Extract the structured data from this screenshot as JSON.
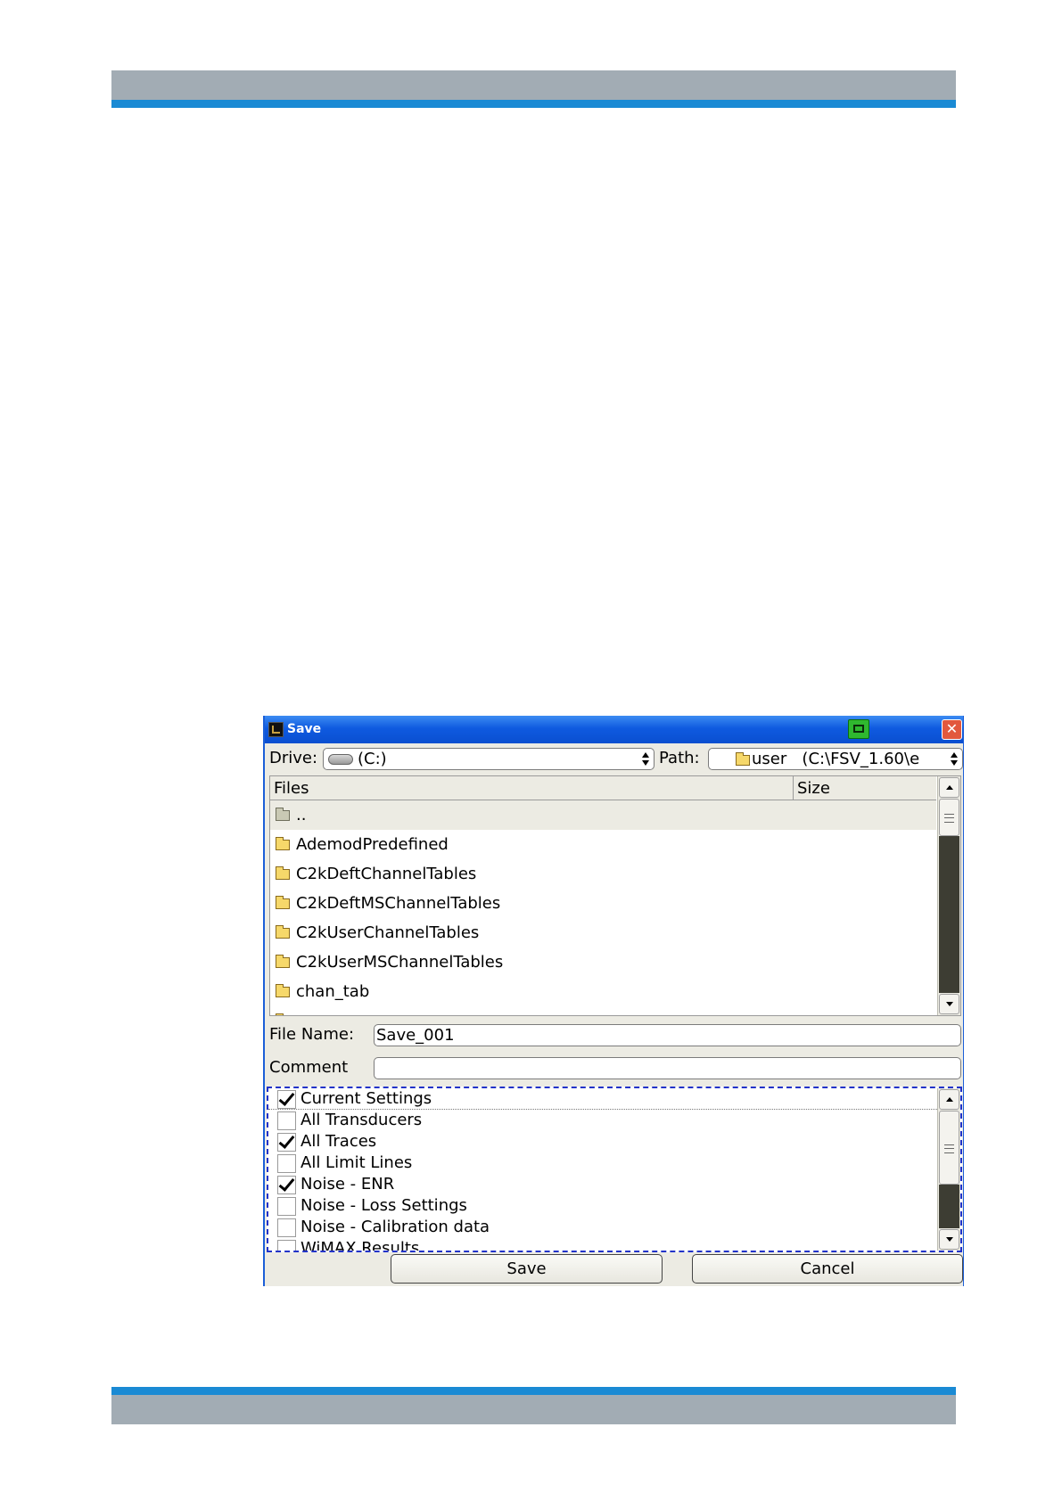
{
  "dialog": {
    "title": "Save",
    "drive_label": "Drive:",
    "drive_value": "(C:)",
    "path_label": "Path:",
    "path_value": "user   (C:\\FSV_1.60\\e",
    "files_header": "Files",
    "size_header": "Size",
    "files": [
      {
        "name": "..",
        "icon": "folder-up-icon",
        "selected": true
      },
      {
        "name": "AdemodPredefined",
        "icon": "folder-icon"
      },
      {
        "name": "C2kDeftChannelTables",
        "icon": "folder-icon"
      },
      {
        "name": "C2kDeftMSChannelTables",
        "icon": "folder-icon"
      },
      {
        "name": "C2kUserChannelTables",
        "icon": "folder-icon"
      },
      {
        "name": "C2kUserMSChannelTables",
        "icon": "folder-icon"
      },
      {
        "name": "chan_tab",
        "icon": "folder-icon"
      },
      {
        "name": "",
        "icon": "folder-icon"
      }
    ],
    "filename_label": "File Name:",
    "filename_value": "Save_001",
    "comment_label": "Comment",
    "comment_value": "",
    "settings": [
      {
        "label": "Current Settings",
        "checked": true
      },
      {
        "label": "All Transducers",
        "checked": false
      },
      {
        "label": "All Traces",
        "checked": true
      },
      {
        "label": "All Limit Lines",
        "checked": false
      },
      {
        "label": "Noise - ENR",
        "checked": true
      },
      {
        "label": "Noise - Loss Settings",
        "checked": false
      },
      {
        "label": "Noise - Calibration data",
        "checked": false
      },
      {
        "label": "WiMAX Results",
        "checked": false
      }
    ],
    "save_label": "Save",
    "cancel_label": "Cancel"
  },
  "colors": {
    "title_bar": "#0f5ae0",
    "dialog_bg": "#ecebe3",
    "page_band": "#a2acb4",
    "page_band_stripe": "#1a8ad4",
    "focus_outline": "#2233c8"
  }
}
